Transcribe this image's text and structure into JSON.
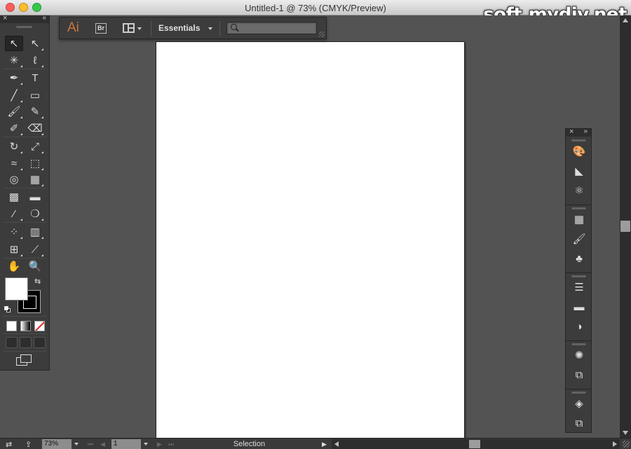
{
  "window": {
    "title": "Untitled-1 @ 73% (CMYK/Preview)",
    "watermark": "soft.mydiv.net"
  },
  "appbar": {
    "logo": "Ai",
    "bridge_label": "Br",
    "workspace": "Essentials",
    "search_placeholder": ""
  },
  "tools_panel": {
    "close_glyph": "×",
    "collapse_glyph": "«",
    "tools": [
      {
        "name": "selection-tool",
        "glyph": "↖",
        "icon": "selection-arrow-icon"
      },
      {
        "name": "direct-selection-tool",
        "glyph": "↖",
        "icon": "direct-selection-icon"
      },
      {
        "name": "magic-wand-tool",
        "glyph": "✳",
        "icon": "magic-wand-icon"
      },
      {
        "name": "lasso-tool",
        "glyph": "ℓ",
        "icon": "lasso-icon"
      },
      {
        "name": "pen-tool",
        "glyph": "✒",
        "icon": "pen-icon"
      },
      {
        "name": "type-tool",
        "glyph": "T",
        "icon": "type-icon"
      },
      {
        "name": "line-segment-tool",
        "glyph": "╱",
        "icon": "line-icon"
      },
      {
        "name": "rectangle-tool",
        "glyph": "▭",
        "icon": "rectangle-icon"
      },
      {
        "name": "paintbrush-tool",
        "glyph": "🖌",
        "icon": "paintbrush-icon"
      },
      {
        "name": "pencil-tool",
        "glyph": "✎",
        "icon": "pencil-icon"
      },
      {
        "name": "blob-brush-tool",
        "glyph": "✐",
        "icon": "blob-brush-icon"
      },
      {
        "name": "eraser-tool",
        "glyph": "⌫",
        "icon": "eraser-icon"
      },
      {
        "name": "rotate-tool",
        "glyph": "↻",
        "icon": "rotate-icon"
      },
      {
        "name": "scale-tool",
        "glyph": "⤢",
        "icon": "scale-icon"
      },
      {
        "name": "width-tool",
        "glyph": "≈",
        "icon": "width-icon"
      },
      {
        "name": "free-transform-tool",
        "glyph": "⬚",
        "icon": "free-transform-icon"
      },
      {
        "name": "shape-builder-tool",
        "glyph": "◎",
        "icon": "shape-builder-icon"
      },
      {
        "name": "perspective-grid-tool",
        "glyph": "▦",
        "icon": "perspective-grid-icon"
      },
      {
        "name": "mesh-tool",
        "glyph": "▩",
        "icon": "mesh-icon"
      },
      {
        "name": "gradient-tool",
        "glyph": "▬",
        "icon": "gradient-icon"
      },
      {
        "name": "eyedropper-tool",
        "glyph": "⁄",
        "icon": "eyedropper-icon"
      },
      {
        "name": "blend-tool",
        "glyph": "❍",
        "icon": "blend-icon"
      },
      {
        "name": "symbol-sprayer-tool",
        "glyph": "⁘",
        "icon": "symbol-sprayer-icon"
      },
      {
        "name": "column-graph-tool",
        "glyph": "▥",
        "icon": "column-graph-icon"
      },
      {
        "name": "artboard-tool",
        "glyph": "⊞",
        "icon": "artboard-icon"
      },
      {
        "name": "slice-tool",
        "glyph": "⟋",
        "icon": "slice-icon"
      },
      {
        "name": "hand-tool",
        "glyph": "✋",
        "icon": "hand-icon"
      },
      {
        "name": "zoom-tool",
        "glyph": "🔍",
        "icon": "zoom-icon"
      }
    ],
    "swap_glyph": "⇆",
    "fill_color": "#ffffff",
    "stroke_color": "#000000"
  },
  "dock": {
    "close_glyph": "×",
    "expand_glyph": "»",
    "groups": [
      [
        {
          "name": "color-panel-button",
          "glyph": "🎨",
          "icon": "color-palette-icon"
        },
        {
          "name": "color-guide-panel-button",
          "glyph": "◣",
          "icon": "color-guide-icon"
        },
        {
          "name": "kuler-panel-button",
          "glyph": "⚛",
          "icon": "kuler-icon"
        }
      ],
      [
        {
          "name": "swatches-panel-button",
          "glyph": "▦",
          "icon": "swatches-grid-icon"
        },
        {
          "name": "brushes-panel-button",
          "glyph": "🖌",
          "icon": "brushes-icon"
        },
        {
          "name": "symbols-panel-button",
          "glyph": "♣",
          "icon": "symbols-club-icon"
        }
      ],
      [
        {
          "name": "stroke-panel-button",
          "glyph": "☰",
          "icon": "stroke-lines-icon"
        },
        {
          "name": "gradient-panel-button",
          "glyph": "▬",
          "icon": "gradient-icon"
        },
        {
          "name": "transparency-panel-button",
          "glyph": "◑",
          "icon": "transparency-icon"
        }
      ],
      [
        {
          "name": "appearance-panel-button",
          "glyph": "✺",
          "icon": "appearance-icon"
        },
        {
          "name": "graphic-styles-panel-button",
          "glyph": "⧉",
          "icon": "graphic-styles-icon"
        }
      ],
      [
        {
          "name": "layers-panel-button",
          "glyph": "◈",
          "icon": "layers-icon"
        },
        {
          "name": "artboards-panel-button",
          "glyph": "⧉",
          "icon": "artboards-icon"
        }
      ]
    ]
  },
  "statusbar": {
    "zoom": "73%",
    "page": "1",
    "status_text": "Selection",
    "first_glyph": "⏮",
    "prev_glyph": "◀",
    "next_glyph": "▶",
    "last_glyph": "⏭",
    "menu_glyph": "▶"
  }
}
